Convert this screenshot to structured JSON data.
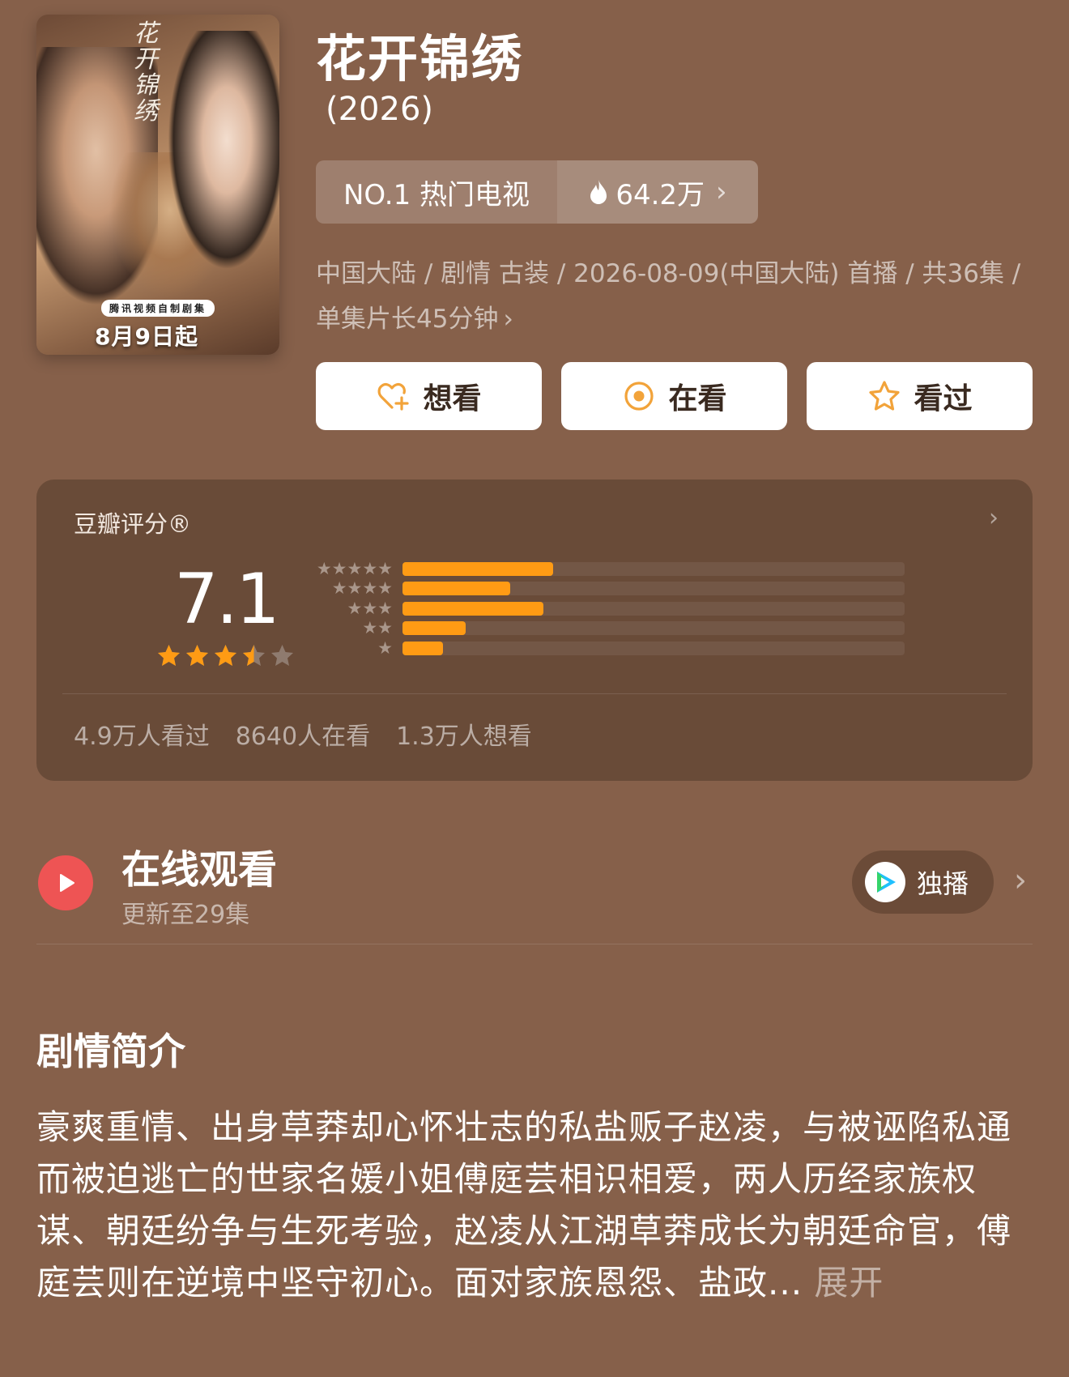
{
  "poster": {
    "calligraphy": "花开锦绣",
    "badge": "腾讯视频自制剧集",
    "date": "8月9日起"
  },
  "title": "花开锦绣",
  "year": "(2026)",
  "rank": {
    "label": "NO.1 热门电视",
    "heat": "64.2万",
    "chevron": "›"
  },
  "meta": {
    "text": "中国大陆 / 剧情 古装 / 2026-08-09(中国大陆) 首播 / 共36集 / 单集片长45分钟",
    "chevron": "›"
  },
  "actions": [
    {
      "label": "想看",
      "icon": "heart-plus-icon"
    },
    {
      "label": "在看",
      "icon": "target-icon"
    },
    {
      "label": "看过",
      "icon": "star-outline-icon"
    }
  ],
  "rating": {
    "label": "豆瓣评分®",
    "more": "›",
    "score": "7.1",
    "stars": 3.5,
    "distribution": [
      {
        "stars": 5,
        "fraction": 0.3
      },
      {
        "stars": 4,
        "fraction": 0.215
      },
      {
        "stars": 3,
        "fraction": 0.28
      },
      {
        "stars": 2,
        "fraction": 0.125
      },
      {
        "stars": 1,
        "fraction": 0.08
      }
    ],
    "counts": [
      "4.9万人看过",
      "8640人在看",
      "1.3万人想看"
    ]
  },
  "watch": {
    "title": "在线观看",
    "subtitle": "更新至29集",
    "exclusive": "独播",
    "chevron": "›"
  },
  "synopsis": {
    "title": "剧情简介",
    "body": "豪爽重情、出身草莽却心怀壮志的私盐贩子赵凌，与被诬陷私通而被迫逃亡的世家名媛小姐傅庭芸相识相爱，两人历经家族权谋、朝廷纷争与生死考验，赵凌从江湖草莽成长为朝廷命官，傅庭芸则在逆境中坚守初心。面对家族恩怨、盐政...",
    "expand": "展开"
  },
  "colors": {
    "background": "#86604a",
    "card": "#694b38",
    "accent": "#ff9b14",
    "play": "#ee5454"
  }
}
